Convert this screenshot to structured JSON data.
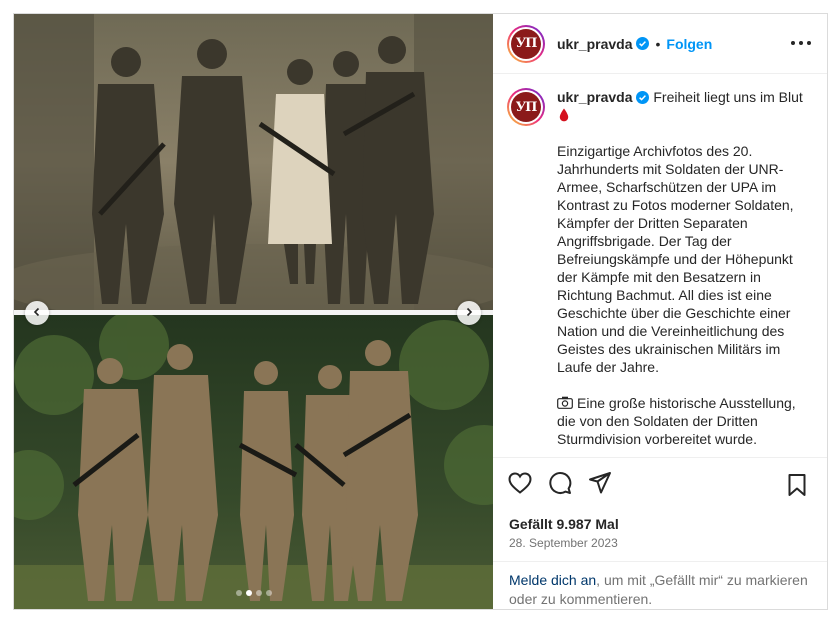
{
  "account": {
    "username": "ukr_pravda",
    "avatar_text": "УП",
    "verified": true,
    "follow_label": "Folgen",
    "separator": "•"
  },
  "caption": {
    "username": "ukr_pravda",
    "title": "Freiheit liegt uns im Blut",
    "paragraph1": "Einzigartige Archivfotos des 20. Jahrhunderts mit Soldaten der UNR-Armee, Scharfschützen der UPA im Kontrast zu Fotos moderner Soldaten, Kämpfer der Dritten Separaten Angriffsbrigade. Der Tag der Befreiungskämpfe und der Höhepunkt der Kämpfe mit den Besatzern in Richtung Bachmut. All dies ist eine Geschichte über die Geschichte einer Nation und die Vereinheitlichung des Geistes des ukrainischen Militärs im Laufe der Jahre.",
    "paragraph2": "Eine große historische Ausstellung, die von den Soldaten der Dritten Sturmdivision vorbereitet wurde."
  },
  "carousel": {
    "total_slides": 4,
    "active_index": 1
  },
  "engagement": {
    "likes_text": "Gefällt 9.987 Mal",
    "date_text": "28. September 2023"
  },
  "login_prompt": {
    "link_text": "Melde dich an",
    "rest_text": ", um mit „Gefällt mir“ zu markieren oder zu kommentieren."
  },
  "icons": {
    "like": "heart-icon",
    "comment": "comment-icon",
    "share": "share-icon",
    "save": "bookmark-icon",
    "more": "more-options-icon",
    "verified": "verified-badge-icon",
    "prev": "chevron-left-icon",
    "next": "chevron-right-icon"
  },
  "colors": {
    "link_blue": "#0095f6",
    "verified_blue": "#0095f6",
    "blood_red": "#d4111e",
    "avatar_bg": "#8b1a1a"
  }
}
